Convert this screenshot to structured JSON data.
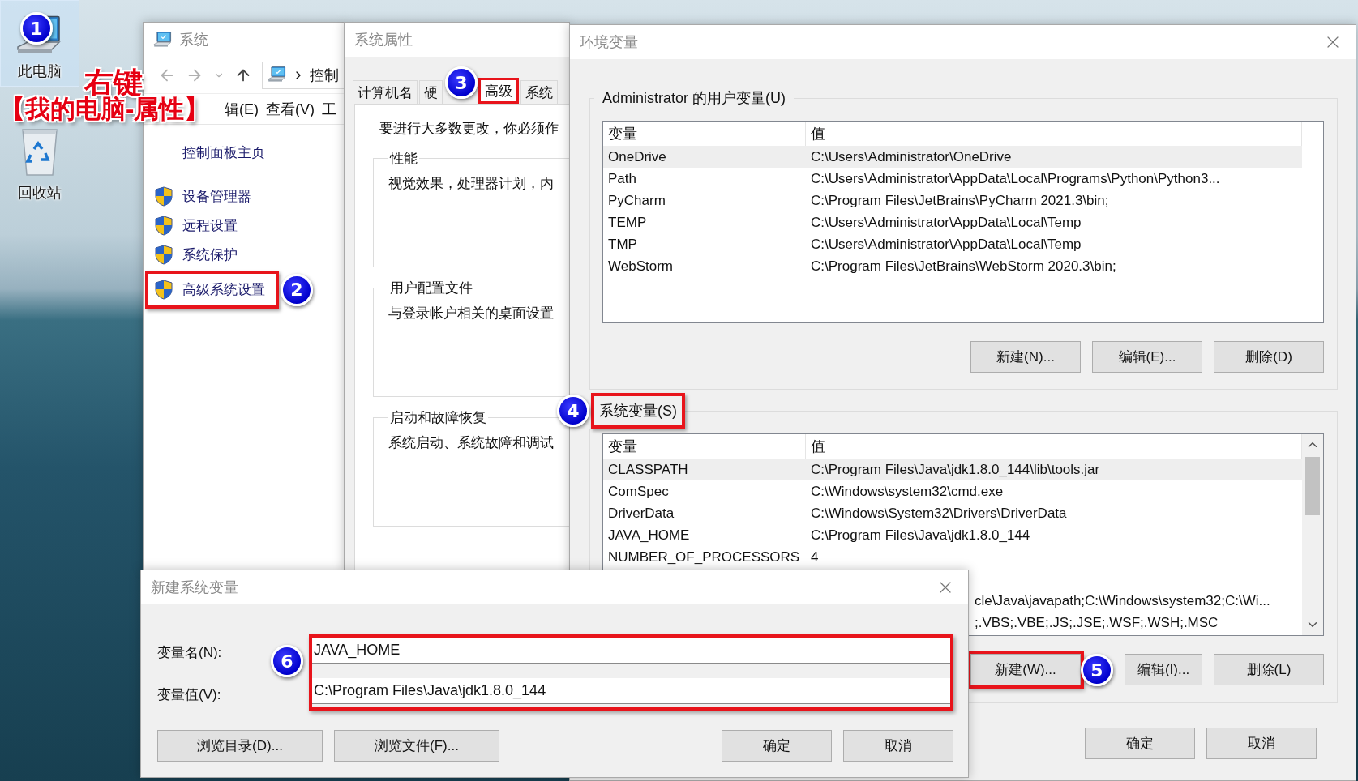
{
  "desktop": {
    "icons": [
      {
        "kind": "computer",
        "label": "此电脑",
        "selected": true,
        "step": "1"
      },
      {
        "kind": "recycle",
        "label": "回收站",
        "selected": false
      }
    ],
    "annotations": [
      "右键",
      "【我的电脑-属性】"
    ]
  },
  "system_window": {
    "title": "系统",
    "address": "控制",
    "menu": [
      "辑(E)",
      "查看(V)",
      "工"
    ],
    "sidebar": [
      {
        "kind": "link",
        "label": "控制面板主页",
        "highlighted": false
      },
      {
        "kind": "shield",
        "label": "设备管理器",
        "highlighted": false
      },
      {
        "kind": "shield",
        "label": "远程设置",
        "highlighted": false
      },
      {
        "kind": "shield",
        "label": "系统保护",
        "highlighted": false
      },
      {
        "kind": "shield",
        "label": "高级系统设置",
        "highlighted": true,
        "step": "2"
      }
    ]
  },
  "properties_window": {
    "title": "系统属性",
    "tabs": [
      {
        "label": "计算机名",
        "selected": false,
        "highlighted": false
      },
      {
        "label": "硬",
        "selected": false,
        "highlighted": false
      },
      {
        "label": "高级",
        "selected": true,
        "highlighted": true,
        "step": "3"
      },
      {
        "label": "系统",
        "selected": false,
        "highlighted": false
      }
    ],
    "notice": "要进行大多数更改，你必须作",
    "groups": [
      {
        "title": "性能",
        "text": "视觉效果，处理器计划，内"
      },
      {
        "title": "用户配置文件",
        "text": "与登录帐户相关的桌面设置"
      },
      {
        "title": "启动和故障恢复",
        "text": "系统启动、系统故障和调试"
      }
    ]
  },
  "environment_window": {
    "title": "环境变量",
    "user_variables": {
      "title": "Administrator 的用户变量(U)",
      "highlighted": false,
      "columns": [
        "变量",
        "值"
      ],
      "rows": [
        {
          "kind": "full",
          "name": "OneDrive",
          "value": "C:\\Users\\Administrator\\OneDrive",
          "selected": true
        },
        {
          "kind": "full",
          "name": "Path",
          "value": "C:\\Users\\Administrator\\AppData\\Local\\Programs\\Python\\Python3...",
          "selected": false
        },
        {
          "kind": "full",
          "name": "PyCharm",
          "value": "C:\\Program Files\\JetBrains\\PyCharm 2021.3\\bin;",
          "selected": false
        },
        {
          "kind": "full",
          "name": "TEMP",
          "value": "C:\\Users\\Administrator\\AppData\\Local\\Temp",
          "selected": false
        },
        {
          "kind": "full",
          "name": "TMP",
          "value": "C:\\Users\\Administrator\\AppData\\Local\\Temp",
          "selected": false
        },
        {
          "kind": "full",
          "name": "WebStorm",
          "value": "C:\\Program Files\\JetBrains\\WebStorm 2020.3\\bin;",
          "selected": false
        }
      ],
      "buttons": [
        {
          "label": "新建(N)...",
          "highlighted": false
        },
        {
          "label": "编辑(E)...",
          "highlighted": false
        },
        {
          "label": "删除(D)",
          "highlighted": false
        }
      ]
    },
    "system_variables": {
      "title": "系统变量(S)",
      "highlighted": true,
      "step": "4",
      "columns": [
        "变量",
        "值"
      ],
      "rows": [
        {
          "kind": "full",
          "name": "CLASSPATH",
          "value": "C:\\Program Files\\Java\\jdk1.8.0_144\\lib\\tools.jar",
          "selected": true
        },
        {
          "kind": "full",
          "name": "ComSpec",
          "value": "C:\\Windows\\system32\\cmd.exe",
          "selected": false
        },
        {
          "kind": "full",
          "name": "DriverData",
          "value": "C:\\Windows\\System32\\Drivers\\DriverData",
          "selected": false
        },
        {
          "kind": "full",
          "name": "JAVA_HOME",
          "value": "C:\\Program Files\\Java\\jdk1.8.0_144",
          "selected": false
        },
        {
          "kind": "full",
          "name": "NUMBER_OF_PROCESSORS",
          "value": "4",
          "selected": false
        },
        {
          "kind": "clipped",
          "value": "cle\\Java\\javapath;C:\\Windows\\system32;C:\\Wi...",
          "selected": false
        },
        {
          "kind": "clipped",
          "value": ";.VBS;.VBE;.JS;.JSE;.WSF;.WSH;.MSC",
          "selected": false
        }
      ],
      "buttons": [
        {
          "label": "新建(W)...",
          "highlighted": true,
          "step": "5"
        },
        {
          "label": "编辑(I)...",
          "highlighted": false
        },
        {
          "label": "删除(L)",
          "highlighted": false
        }
      ]
    },
    "buttons": [
      {
        "label": "确定",
        "highlighted": false
      },
      {
        "label": "取消",
        "highlighted": false
      }
    ]
  },
  "new_variable_dialog": {
    "title": "新建系统变量",
    "fields_highlighted": true,
    "step": "6",
    "fields": [
      {
        "label": "变量名(N):",
        "value": "JAVA_HOME"
      },
      {
        "label": "变量值(V):",
        "value": "C:\\Program Files\\Java\\jdk1.8.0_144"
      }
    ],
    "browse_buttons": [
      {
        "label": "浏览目录(D)...",
        "highlighted": false
      },
      {
        "label": "浏览文件(F)...",
        "highlighted": false
      }
    ],
    "buttons": [
      {
        "label": "确定",
        "highlighted": false
      },
      {
        "label": "取消",
        "highlighted": false
      }
    ]
  }
}
